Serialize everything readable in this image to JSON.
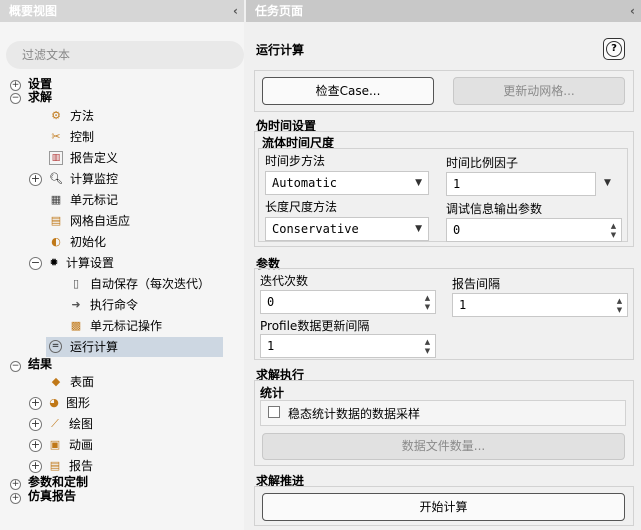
{
  "left_panel": {
    "title": "概要视图",
    "collapse_glyph": "‹",
    "filter_placeholder": "过滤文本",
    "tree": {
      "setup": "设置",
      "solution": "求解",
      "methods": "方法",
      "controls": "控制",
      "report_definitions": "报告定义",
      "monitors": "计算监控",
      "cell_registers": "单元标记",
      "adaption": "网格自适应",
      "initialization": "初始化",
      "calc_activities": "计算设置",
      "autosave": "自动保存（每次迭代）",
      "execute_commands": "执行命令",
      "cell_register_ops": "单元标记操作",
      "run_calculation": "运行计算",
      "results": "结果",
      "surfaces": "表面",
      "graphics": "图形",
      "plots": "绘图",
      "animations": "动画",
      "reports": "报告",
      "parameters": "参数和定制",
      "simulation_reports": "仿真报告"
    }
  },
  "right_panel": {
    "title": "任务页面",
    "collapse_glyph": "‹",
    "page_title": "运行计算",
    "help_glyph": "?",
    "check_case_button": "检查Case...",
    "update_dynamic_mesh_button": "更新动网格...",
    "pseudo_time_section": "伪时间设置",
    "fluid_time_scale": "流体时间尺度",
    "time_step_method_label": "时间步方法",
    "time_step_method_value": "Automatic",
    "time_scale_factor_label": "时间比例因子",
    "time_scale_factor_value": "1",
    "length_scale_method_label": "长度尺度方法",
    "length_scale_method_value": "Conservative",
    "verbosity_label": "调试信息输出参数",
    "verbosity_value": "0",
    "parameters_section": "参数",
    "iterations_label": "迭代次数",
    "iterations_value": "0",
    "reporting_interval_label": "报告间隔",
    "reporting_interval_value": "1",
    "profile_update_label": "Profile数据更新间隔",
    "profile_update_value": "1",
    "solution_processing_section": "求解执行",
    "statistics_label": "统计",
    "sampling_checkbox_label": "稳态统计数据的数据采样",
    "data_file_quantities_button": "数据文件数量...",
    "solution_advancement_section": "求解推进",
    "calculate_button": "开始计算"
  }
}
